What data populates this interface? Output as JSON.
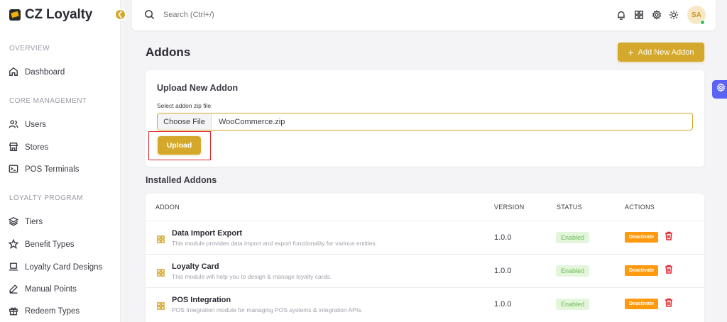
{
  "brand": {
    "name": "CZ Loyalty"
  },
  "sidebar": {
    "sections": [
      {
        "title": "OVERVIEW"
      },
      {
        "title": "CORE MANAGEMENT"
      },
      {
        "title": "LOYALTY PROGRAM"
      }
    ],
    "items": [
      {
        "label": "Dashboard",
        "icon": "home-icon"
      },
      {
        "label": "Users",
        "icon": "users-icon"
      },
      {
        "label": "Stores",
        "icon": "store-icon"
      },
      {
        "label": "POS Terminals",
        "icon": "terminal-icon"
      },
      {
        "label": "Tiers",
        "icon": "layers-icon"
      },
      {
        "label": "Benefit Types",
        "icon": "star-icon"
      },
      {
        "label": "Loyalty Card Designs",
        "icon": "laptop-icon"
      },
      {
        "label": "Manual Points",
        "icon": "pen-icon"
      },
      {
        "label": "Redeem Types",
        "icon": "gift-icon"
      }
    ]
  },
  "topbar": {
    "search_placeholder": "Search (Ctrl+/)",
    "icons": [
      "bell-icon",
      "grid-icon",
      "gear-icon",
      "sun-icon"
    ],
    "avatar_initials": "SA"
  },
  "page": {
    "title": "Addons",
    "add_button": "Add New Addon"
  },
  "upload": {
    "title": "Upload New Addon",
    "file_label": "Select addon zip file",
    "choose_file": "Choose File",
    "file_name": "WooCommerce.zip",
    "upload_button": "Upload"
  },
  "installed": {
    "title": "Installed Addons",
    "columns": [
      "ADDON",
      "VERSION",
      "STATUS",
      "ACTIONS"
    ],
    "rows": [
      {
        "name": "Data Import Export",
        "description": "This module provides data import and export functionality for various entities.",
        "version": "1.0.0",
        "status": "Enabled",
        "action": "Deactivate"
      },
      {
        "name": "Loyalty Card",
        "description": "This module will help you to design & manage loyalty cards.",
        "version": "1.0.0",
        "status": "Enabled",
        "action": "Deactivate"
      },
      {
        "name": "POS Integration",
        "description": "POS Integration module for managing POS systems & integration APIs.",
        "version": "1.0.0",
        "status": "Enabled",
        "action": "Deactivate"
      }
    ]
  },
  "colors": {
    "accent": "#d4a82a",
    "enabled_badge_bg": "#e3f6dc",
    "enabled_badge_text": "#6bbd4f",
    "deactivate": "#ff9a0e",
    "danger": "#e0262d",
    "float_settings": "#5b63f5"
  }
}
